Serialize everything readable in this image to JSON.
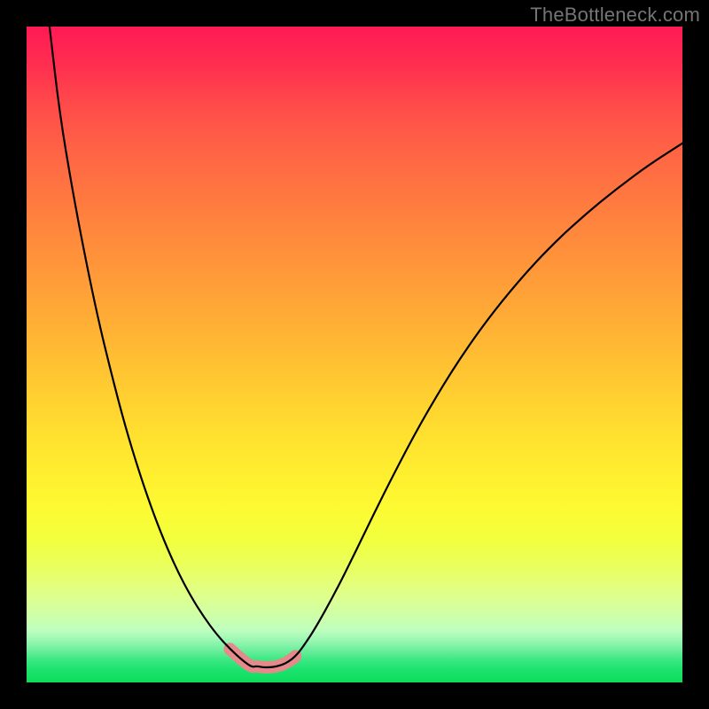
{
  "watermark": "TheBottleneck.com",
  "colors": {
    "black": "#000000",
    "overlay_pink": "#e58a8a",
    "gradient_top": "#ff1955",
    "gradient_mid": "#ffe22f",
    "gradient_bottom": "#0cdd5d"
  },
  "chart_data": {
    "type": "line",
    "title": "",
    "xlabel": "",
    "ylabel": "",
    "xlim": [
      0,
      100
    ],
    "ylim": [
      0,
      100
    ],
    "x": [
      3.5,
      5,
      7,
      9,
      11,
      13,
      15,
      17,
      19,
      21,
      23,
      25,
      27,
      29,
      31,
      33,
      34.4,
      35,
      36,
      37,
      38,
      39,
      40,
      41,
      42,
      44,
      47,
      50,
      53,
      56,
      60,
      65,
      70,
      75,
      80,
      85,
      90,
      95,
      100
    ],
    "values": [
      100,
      87,
      75,
      64.5,
      55,
      46.8,
      39.2,
      32.6,
      26.7,
      21.5,
      17,
      13.2,
      10,
      7.3,
      5.1,
      3.3,
      2.3,
      2.5,
      2.3,
      2.3,
      2.4,
      2.7,
      3.2,
      4,
      5.2,
      8.2,
      13.6,
      19.6,
      25.8,
      31.8,
      39.4,
      47.8,
      55,
      61.2,
      66.6,
      71.2,
      75.3,
      79,
      82.2
    ],
    "highlight_x_range": [
      29.5,
      41.5
    ],
    "highlight_y_max": 10
  }
}
